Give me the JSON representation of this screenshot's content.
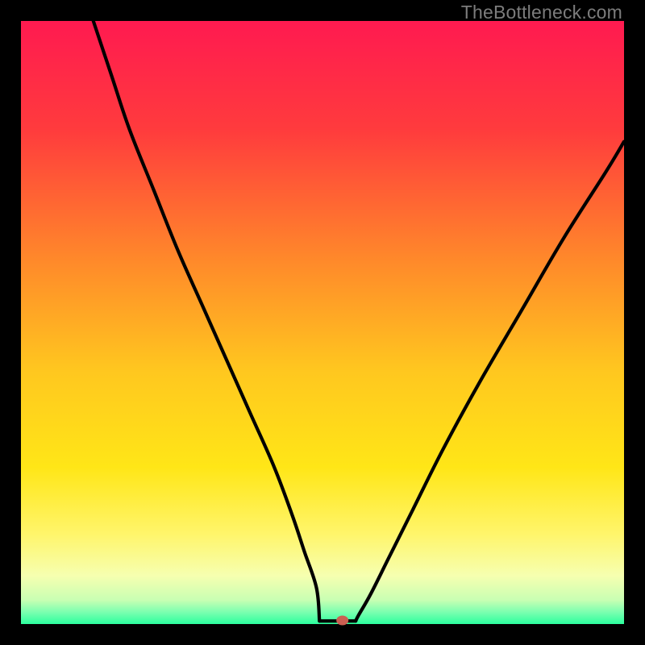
{
  "watermark": "TheBottleneck.com",
  "gradient": {
    "stops": [
      {
        "pct": 0,
        "color": "#ff1a50"
      },
      {
        "pct": 18,
        "color": "#ff3b3d"
      },
      {
        "pct": 40,
        "color": "#ff8a2a"
      },
      {
        "pct": 58,
        "color": "#ffc71f"
      },
      {
        "pct": 74,
        "color": "#ffe617"
      },
      {
        "pct": 85,
        "color": "#fff56a"
      },
      {
        "pct": 92,
        "color": "#f6ffb0"
      },
      {
        "pct": 96,
        "color": "#c9ffb3"
      },
      {
        "pct": 98,
        "color": "#7cffb0"
      },
      {
        "pct": 100,
        "color": "#2cff9e"
      }
    ]
  },
  "chart_data": {
    "type": "line",
    "title": "",
    "xlabel": "",
    "ylabel": "",
    "xlim": [
      0,
      100
    ],
    "ylim": [
      0,
      100
    ],
    "series": [
      {
        "name": "bottleneck-curve",
        "x": [
          12,
          15,
          18,
          22,
          26,
          30,
          34,
          38,
          42,
          45,
          47,
          49,
          50.5,
          52,
          53.5,
          55,
          56,
          58,
          61,
          65,
          70,
          76,
          83,
          90,
          97,
          100
        ],
        "y": [
          100,
          91,
          82,
          72,
          62,
          53,
          44,
          35,
          26,
          18,
          12,
          6,
          2,
          0.5,
          0.5,
          0.5,
          1.5,
          5,
          11,
          19,
          29,
          40,
          52,
          64,
          75,
          80
        ]
      }
    ],
    "marker": {
      "x": 53.3,
      "y": 0.6,
      "color": "#cb5f52"
    },
    "flat_segment": {
      "x0": 49.5,
      "x1": 55.5,
      "y": 0.5
    }
  }
}
